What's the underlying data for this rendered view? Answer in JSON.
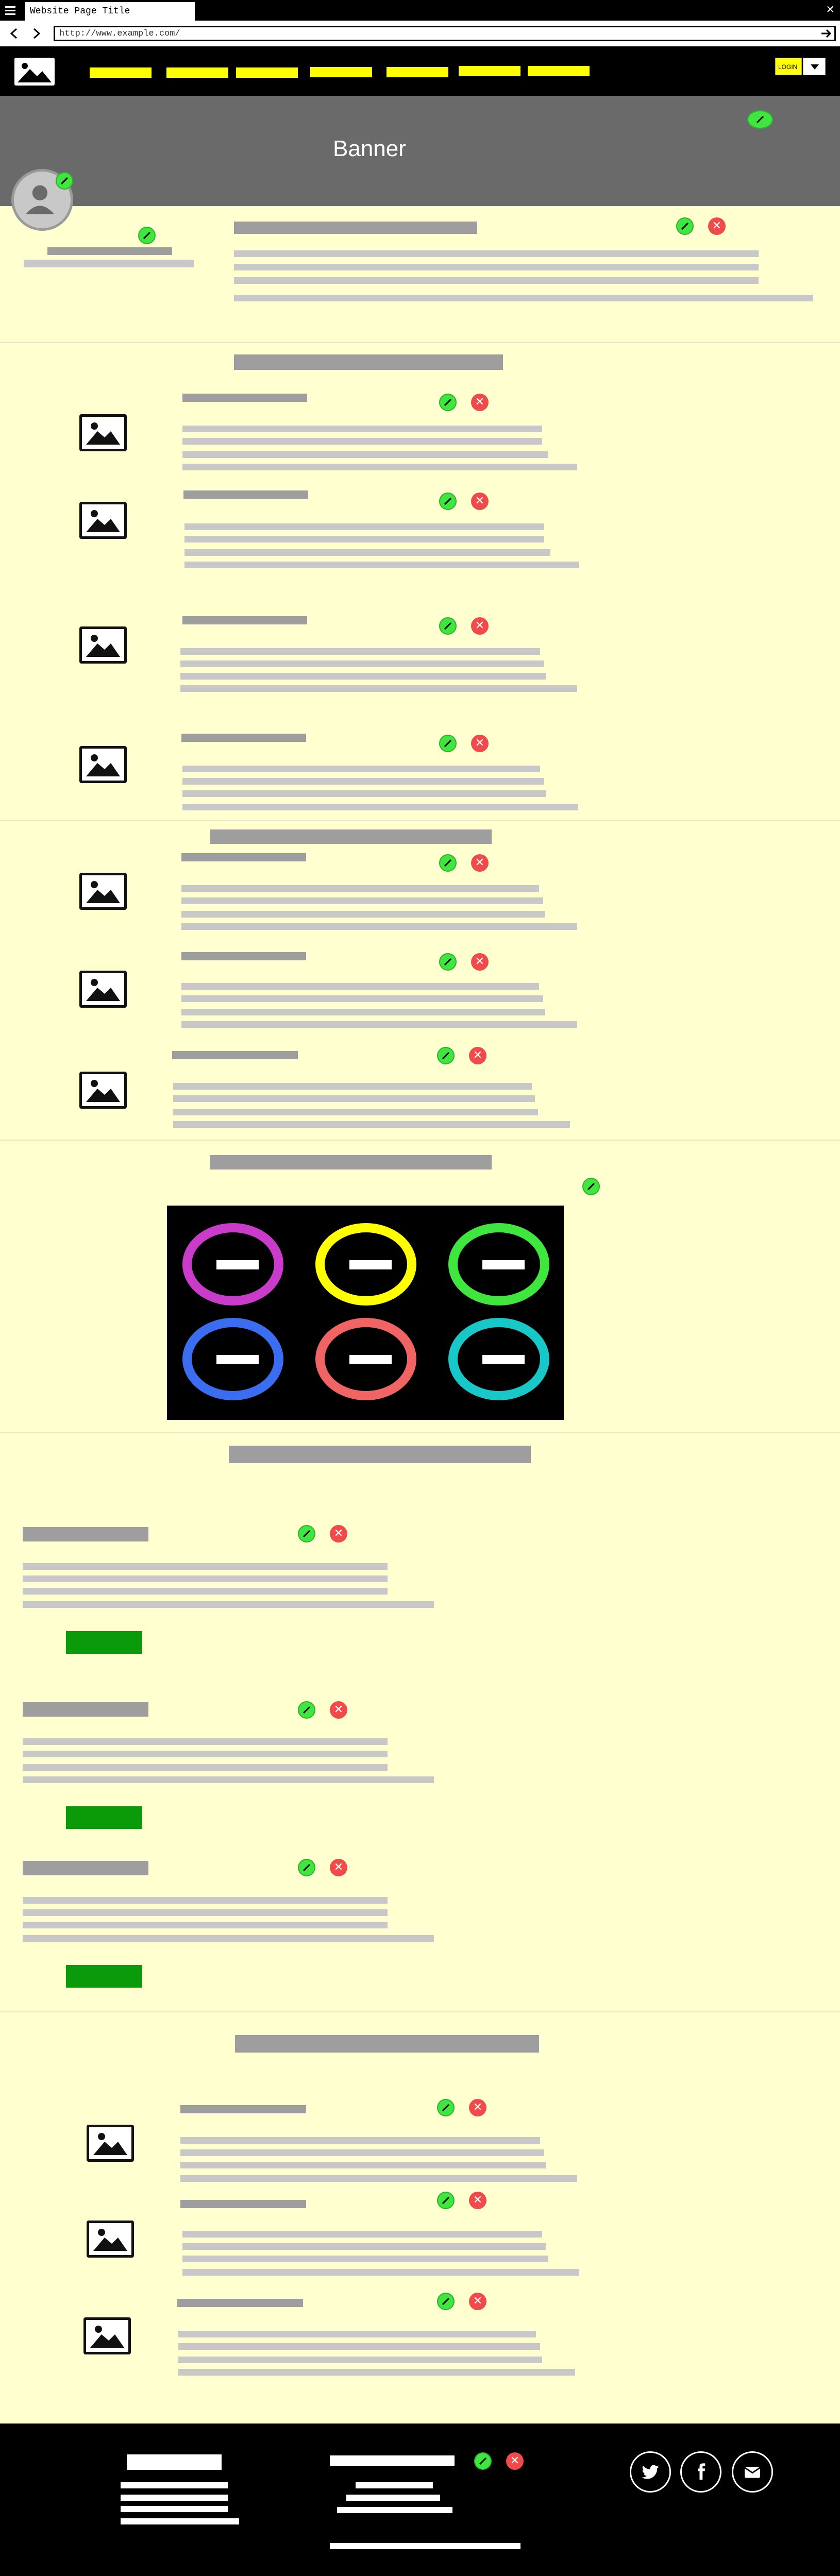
{
  "browser": {
    "tab_title": "Website Page Title",
    "url": "http://www.example.com/",
    "close_glyph": "✕"
  },
  "nav": {
    "login_label": "LOGIN",
    "items_count_note": "",
    "accent": "#ffff00"
  },
  "banner": {
    "title": "Banner",
    "background": "#6a6a6a"
  },
  "carousel": {
    "colors": [
      "#c93cc9",
      "#ffff00",
      "#3ee63e",
      "#3b6df0",
      "#f06464",
      "#18c8c8"
    ]
  },
  "icons": {
    "edit": "pencil-icon",
    "delete": "close-icon",
    "image": "image-placeholder-icon",
    "avatar": "user-avatar-icon",
    "twitter": "twitter-icon",
    "facebook": "facebook-icon",
    "email": "email-icon"
  },
  "colors": {
    "page_bg": "#ffffd0",
    "placeholder_bar": "#9e9e9e",
    "placeholder_line": "#c8c8c8",
    "edit_green": "#3ee63e",
    "delete_red": "#f04a4a",
    "button_green": "#0a9a0a",
    "footer_bg": "#000000"
  }
}
